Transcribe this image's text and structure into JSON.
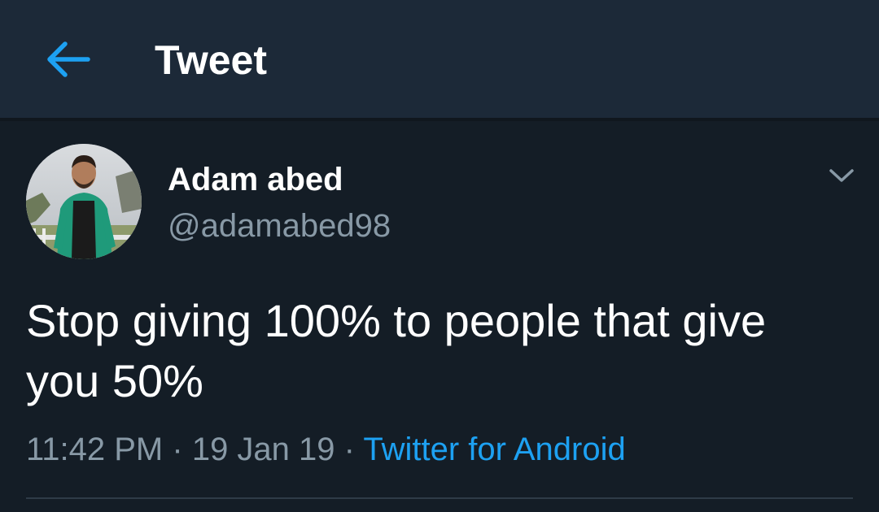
{
  "header": {
    "title": "Tweet",
    "back_icon": "arrow-left-icon"
  },
  "author": {
    "display_name": "Adam abed",
    "handle": "@adamabed98"
  },
  "tweet": {
    "text": "Stop giving 100% to people that give you 50%",
    "time": "11:42 PM",
    "date": "19 Jan 19",
    "source": "Twitter for Android",
    "separator": "·"
  },
  "colors": {
    "background": "#141d26",
    "header_background": "#1c2938",
    "accent": "#1da1f2",
    "secondary_text": "#8899a6"
  },
  "icons": {
    "caret": "chevron-down-icon"
  }
}
